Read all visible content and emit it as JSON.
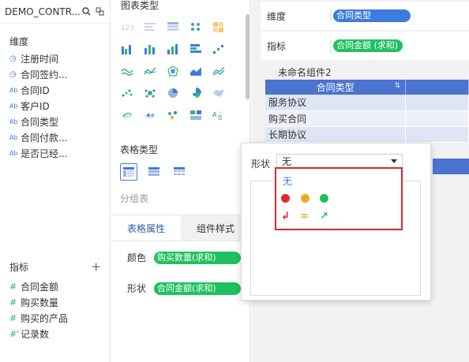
{
  "dataset": {
    "name": "DEMO_CONTR..."
  },
  "dimensions": {
    "title": "维度",
    "fields": [
      {
        "icon": "clock",
        "label": "注册时间"
      },
      {
        "icon": "clock",
        "label": "合同签约..."
      },
      {
        "icon": "Ab",
        "label": "合同ID"
      },
      {
        "icon": "Ab",
        "label": "客户ID"
      },
      {
        "icon": "Ab",
        "label": "合同类型"
      },
      {
        "icon": "Ab",
        "label": "合同付款..."
      },
      {
        "icon": "Ab",
        "label": "是否已经..."
      }
    ]
  },
  "measures": {
    "title": "指标",
    "add": "+",
    "fields": [
      {
        "icon": "#",
        "label": "合同金额"
      },
      {
        "icon": "#",
        "label": "购买数量"
      },
      {
        "icon": "#",
        "label": "购买的产品"
      },
      {
        "icon": "#'",
        "label": "记录数"
      }
    ]
  },
  "panel": {
    "chart_types_title": "图表类型",
    "table_types_title": "表格类型",
    "group_table": "分组表",
    "tabs": [
      {
        "label": "表格属性",
        "active": true
      },
      {
        "label": "组件样式",
        "active": false
      }
    ],
    "color_label": "颜色",
    "color_value": "购买数量(求和)",
    "shape_label": "形状",
    "shape_value": "合同金额(求和)"
  },
  "design": {
    "dimension_label": "维度",
    "dimension_value": "合同类型",
    "measure_label": "指标",
    "measure_value": "合同金额 (求和)",
    "component_title": "未命名组件2",
    "table": {
      "header": "合同类型",
      "rows": [
        "服务协议",
        "购买合同",
        "长期协议"
      ]
    }
  },
  "popup": {
    "label": "形状",
    "selected": "无",
    "options": {
      "none": "无",
      "dots": [
        "#e8262f",
        "#f5a623",
        "#1fc15f"
      ],
      "arrows": [
        {
          "symbol": "↲",
          "color": "#e8262f"
        },
        {
          "symbol": "=",
          "color": "#f5a623"
        },
        {
          "symbol": "↗",
          "color": "#1fc15f"
        }
      ]
    }
  },
  "colors": {
    "accent_blue": "#3d7be0",
    "table_header": "#4b74cf",
    "pill_green": "#1fc15f",
    "highlight_red": "#e0262c"
  }
}
